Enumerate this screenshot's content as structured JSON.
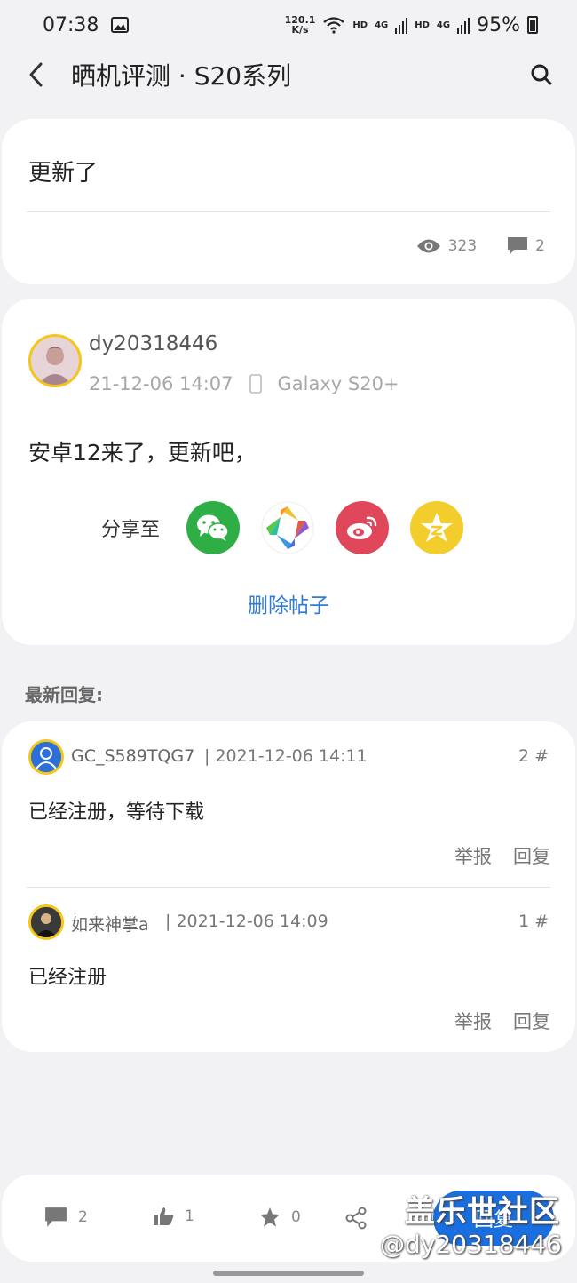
{
  "status_bar": {
    "time": "07:38",
    "net_speed_top": "120.1",
    "net_speed_bottom": "K/s",
    "sig1_hd": "HD",
    "sig1_4g": "4G",
    "sig2_hd": "HD",
    "sig2_4g": "4G",
    "battery": "95%"
  },
  "header": {
    "title": "晒机评测 · S20系列"
  },
  "post": {
    "title": "更新了",
    "views": "323",
    "comments": "2"
  },
  "author_post": {
    "username": "dy20318446",
    "date": "21-12-06 14:07",
    "device": "Galaxy S20+",
    "content": "安卓12来了，更新吧，",
    "share_label": "分享至",
    "delete_label": "删除帖子"
  },
  "replies_section_label": "最新回复:",
  "replies": [
    {
      "username": "GC_S589TQG7",
      "time": "| 2021-12-06 14:11",
      "floor": "2 #",
      "text": "已经注册，等待下载",
      "report": "举报",
      "reply": "回复"
    },
    {
      "username": "如来神掌a",
      "time": "| 2021-12-06 14:09",
      "floor": "1 #",
      "text": "已经注册",
      "report": "举报",
      "reply": "回复"
    }
  ],
  "bottom_bar": {
    "comments": "2",
    "likes": "1",
    "favorites": "0",
    "reply_button": "回复"
  },
  "watermark": {
    "line1": "盖乐世社区",
    "line2": "@dy20318446"
  },
  "colors": {
    "accent": "#1a6fe0",
    "link": "#2f7bd6",
    "wechat": "#2fae46",
    "weibo": "#e0475b",
    "qzone": "#f2cd2b"
  }
}
